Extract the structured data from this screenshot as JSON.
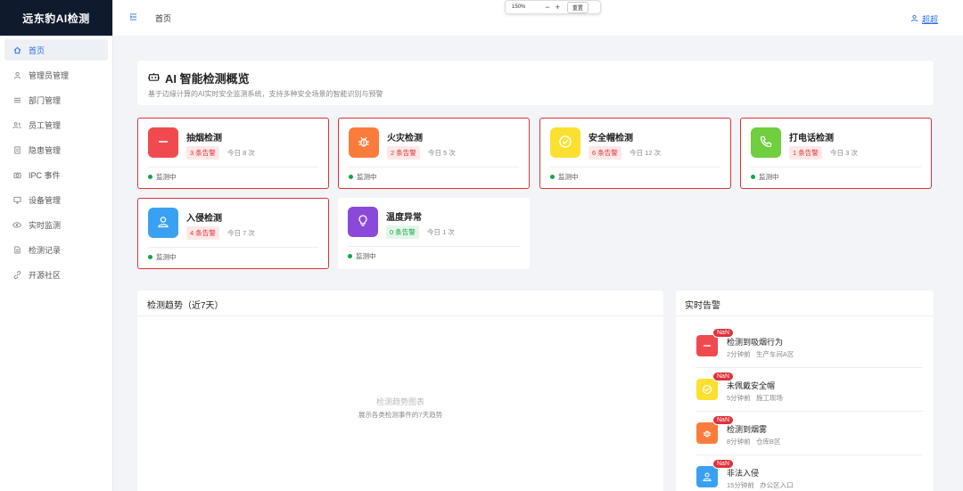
{
  "brand": "远东豹AI检测",
  "header": {
    "title": "首页",
    "user": "超超"
  },
  "zoom": {
    "value": "150%",
    "minus": "−",
    "plus": "+",
    "reset": "重置"
  },
  "nav": [
    {
      "label": "首页",
      "icon": "home-icon"
    },
    {
      "label": "管理员管理",
      "icon": "user-icon"
    },
    {
      "label": "部门管理",
      "icon": "list-icon"
    },
    {
      "label": "员工管理",
      "icon": "users-icon"
    },
    {
      "label": "隐患管理",
      "icon": "document-icon"
    },
    {
      "label": "IPC 事件",
      "icon": "camera-icon"
    },
    {
      "label": "设备管理",
      "icon": "monitor-icon"
    },
    {
      "label": "实时监测",
      "icon": "eye-icon"
    },
    {
      "label": "检测记录",
      "icon": "file-icon"
    },
    {
      "label": "开源社区",
      "icon": "link-icon"
    }
  ],
  "overview": {
    "title": "AI 智能检测概览",
    "subtitle": "基于边缘计算的AI实时安全监测系统，支持多种安全场景的智能识别与预警"
  },
  "cards": [
    {
      "name": "抽烟检测",
      "alerts": "3 条告警",
      "today": "今日 8 次",
      "status": "监测中",
      "color": "#f04a4f",
      "icon": "no-smoking-icon"
    },
    {
      "name": "火灾检测",
      "alerts": "2 条告警",
      "today": "今日 5 次",
      "status": "监测中",
      "color": "#fb7b3c",
      "icon": "bug-icon"
    },
    {
      "name": "安全帽检测",
      "alerts": "6 条告警",
      "today": "今日 12 次",
      "status": "监测中",
      "color": "#fbe030",
      "icon": "check-circle-icon"
    },
    {
      "name": "打电话检测",
      "alerts": "1 条告警",
      "today": "今日 3 次",
      "status": "监测中",
      "color": "#6fcf3e",
      "icon": "phone-icon"
    },
    {
      "name": "入侵检测",
      "alerts": "4 条告警",
      "today": "今日 7 次",
      "status": "监测中",
      "color": "#3aa1f2",
      "icon": "person-icon"
    },
    {
      "name": "温度异常",
      "alerts": "0 条告警",
      "today": "今日 1 次",
      "status": "监测中",
      "color": "#8a49d8",
      "icon": "bulb-icon"
    }
  ],
  "trend": {
    "title": "检测趋势（近7天）",
    "placeholder": "检测趋势图表",
    "desc": "展示各类检测事件的7天趋势"
  },
  "realtime": {
    "title": "实时告警",
    "items": [
      {
        "badge": "NaN",
        "title": "检测到吸烟行为",
        "time": "2分钟前",
        "location": "生产车间A区",
        "color": "#f04a4f",
        "icon": "no-smoking-icon"
      },
      {
        "badge": "NaN",
        "title": "未佩戴安全帽",
        "time": "5分钟前",
        "location": "施工现场",
        "color": "#fbe030",
        "icon": "check-circle-icon"
      },
      {
        "badge": "NaN",
        "title": "检测到烟雾",
        "time": "8分钟前",
        "location": "仓库B区",
        "color": "#fb7b3c",
        "icon": "bug-icon"
      },
      {
        "badge": "NaN",
        "title": "非法入侵",
        "time": "15分钟前",
        "location": "办公区入口",
        "color": "#3aa1f2",
        "icon": "person-icon"
      }
    ]
  }
}
